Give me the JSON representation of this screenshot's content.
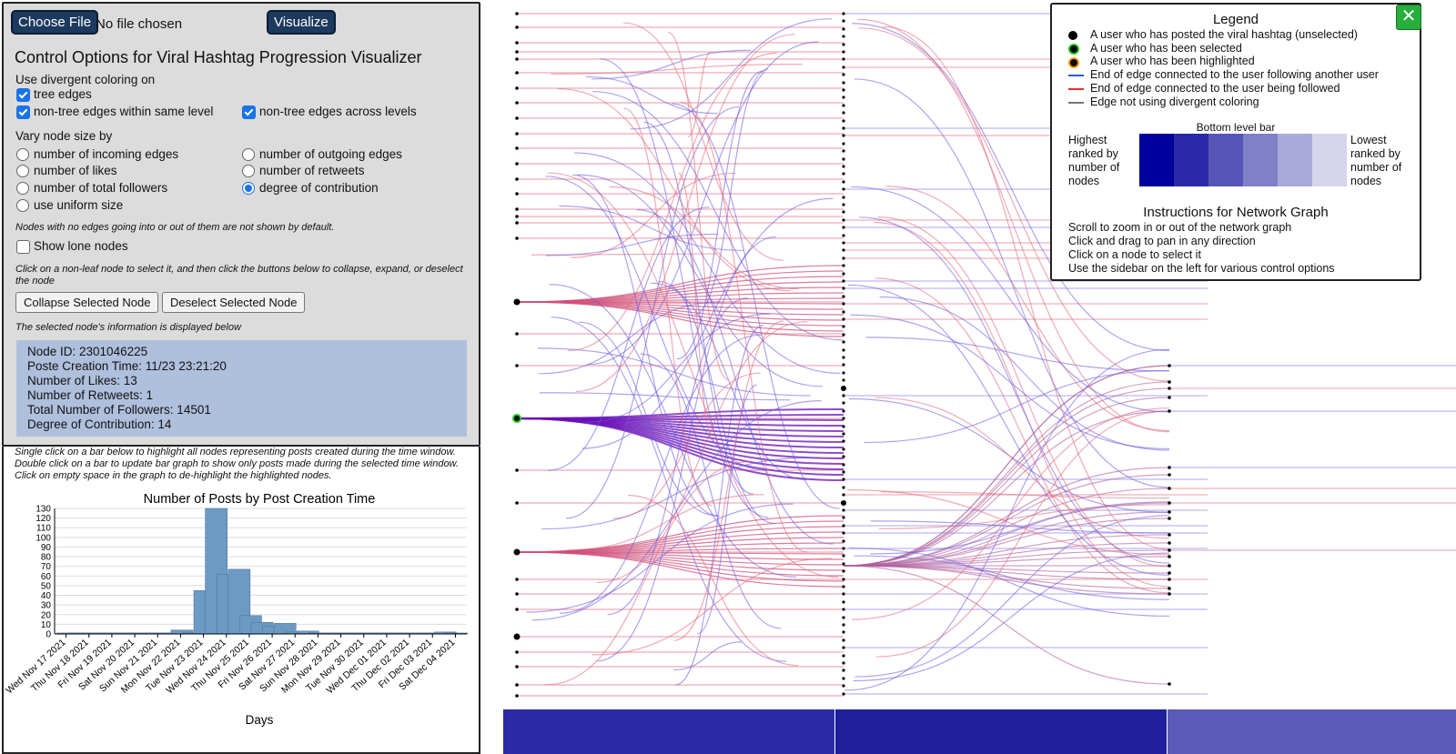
{
  "top": {
    "choose_file": "Choose File",
    "no_file": "No file chosen",
    "visualize": "Visualize"
  },
  "controls": {
    "title": "Control Options for Viral Hashtag Progression Visualizer",
    "divergent_label": "Use divergent coloring on",
    "divergent": [
      {
        "label": "tree edges",
        "checked": true
      },
      {
        "label": "non-tree edges within same level",
        "checked": true
      },
      {
        "label": "non-tree edges across levels",
        "checked": true
      }
    ],
    "size_label": "Vary node size by",
    "size_options": [
      {
        "label": "number of incoming edges",
        "selected": false
      },
      {
        "label": "number of outgoing edges",
        "selected": false
      },
      {
        "label": "number of likes",
        "selected": false
      },
      {
        "label": "number of retweets",
        "selected": false
      },
      {
        "label": "number of total followers",
        "selected": false
      },
      {
        "label": "degree of contribution",
        "selected": true
      },
      {
        "label": "use uniform size",
        "selected": false
      }
    ],
    "lone_note": "Nodes with no edges going into or out of them are not shown by default.",
    "lone_label": "Show lone nodes",
    "lone_checked": false,
    "select_note": "Click on a non-leaf node to select it, and then click the buttons below to collapse, expand, or deselect the node",
    "collapse_btn": "Collapse Selected Node",
    "deselect_btn": "Deselect Selected Node",
    "info_note": "The selected node's information is displayed below",
    "info": [
      "Node ID: 2301046225",
      "Poste Creation Time: 11/23 23:21:20",
      "Number of Likes: 13",
      "Number of Retweets: 1",
      "Total Number of Followers: 14501",
      "Degree of Contribution: 14"
    ]
  },
  "barpanel": {
    "note": "Single click on a bar below to highlight all nodes representing posts created during the time window. Double click on a bar to update bar graph to show only posts made during the selected time window. Click on empty space in the graph to de-highlight the highlighted nodes."
  },
  "chart_data": {
    "type": "bar",
    "title": "Number of Posts by Post Creation Time",
    "xlabel": "Days",
    "ylabel": "",
    "ylim": [
      0,
      130
    ],
    "yticks": [
      0,
      10,
      20,
      30,
      40,
      50,
      60,
      70,
      80,
      90,
      100,
      110,
      120,
      130
    ],
    "categories": [
      "Wed Nov 17 2021",
      "Thu Nov 18 2021",
      "Fri Nov 19 2021",
      "Sat Nov 20 2021",
      "Sun Nov 21 2021",
      "Mon Nov 22 2021",
      "Tue Nov 23 2021",
      "Wed Nov 24 2021",
      "Thu Nov 25 2021",
      "Fri Nov 26 2021",
      "Sat Nov 27 2021",
      "Sun Nov 28 2021",
      "Mon Nov 29 2021",
      "Tue Nov 30 2021",
      "Wed Dec 01 2021",
      "Thu Dec 02 2021",
      "Fri Dec 03 2021",
      "Sat Dec 04 2021"
    ],
    "bars": [
      {
        "start": 0.0,
        "value": 1
      },
      {
        "start": 0.5,
        "value": 1
      },
      {
        "start": 1.0,
        "value": 1
      },
      {
        "start": 1.5,
        "value": 1
      },
      {
        "start": 2.0,
        "value": 1
      },
      {
        "start": 2.5,
        "value": 1
      },
      {
        "start": 3.0,
        "value": 1
      },
      {
        "start": 3.5,
        "value": 1
      },
      {
        "start": 4.0,
        "value": 1
      },
      {
        "start": 4.5,
        "value": 1
      },
      {
        "start": 5.0,
        "value": 4
      },
      {
        "start": 5.5,
        "value": 1
      },
      {
        "start": 6.0,
        "value": 45
      },
      {
        "start": 6.5,
        "value": 130
      },
      {
        "start": 7.0,
        "value": 62
      },
      {
        "start": 7.5,
        "value": 67
      },
      {
        "start": 8.0,
        "value": 19
      },
      {
        "start": 8.5,
        "value": 12
      },
      {
        "start": 9.0,
        "value": 8
      },
      {
        "start": 9.5,
        "value": 11
      },
      {
        "start": 10.0,
        "value": 2
      },
      {
        "start": 10.5,
        "value": 3
      },
      {
        "start": 11.0,
        "value": 1
      },
      {
        "start": 11.5,
        "value": 1
      },
      {
        "start": 12.0,
        "value": 1
      },
      {
        "start": 12.5,
        "value": 1
      },
      {
        "start": 13.0,
        "value": 1
      },
      {
        "start": 13.5,
        "value": 1
      },
      {
        "start": 14.0,
        "value": 1
      },
      {
        "start": 14.5,
        "value": 1
      },
      {
        "start": 15.0,
        "value": 1
      },
      {
        "start": 15.5,
        "value": 1
      },
      {
        "start": 16.0,
        "value": 1
      },
      {
        "start": 16.5,
        "value": 2
      },
      {
        "start": 17.0,
        "value": 1
      }
    ],
    "bar_color": "#6b9ac4",
    "grid": true
  },
  "legend": {
    "title": "Legend",
    "items": [
      {
        "label": "A user who has posted the viral hashtag (unselected)",
        "icon": "black-dot"
      },
      {
        "label": "A user who has been selected",
        "icon": "green-ring-dot"
      },
      {
        "label": "A user who has been highlighted",
        "icon": "orange-ring-dot"
      },
      {
        "label": "End of edge connected to the user following another user",
        "icon": "blue-line",
        "color": "#2a5bd7"
      },
      {
        "label": "End of edge connected to the user being followed",
        "icon": "red-line",
        "color": "#e03030"
      },
      {
        "label": "Edge not using divergent coloring",
        "icon": "gray-line",
        "color": "#777777"
      }
    ],
    "bar_title": "Bottom level bar",
    "highest": "Highest ranked by number of nodes",
    "lowest": "Lowest ranked by number of nodes",
    "bar_colors": [
      "#00009c",
      "#2a2aa8",
      "#5555b8",
      "#8080c9",
      "#aaaadc",
      "#d5d5ed"
    ],
    "instructions_title": "Instructions for Network Graph",
    "instructions": [
      "Scroll to zoom in or out of the network graph",
      "Click and drag to pan in any direction",
      "Click on a node to select it",
      "Use the sidebar on the left for various control options"
    ],
    "close": "✕"
  },
  "bottom_bar": {
    "colors": [
      "#2b2ba6",
      "#1f1f9c",
      "#5a5ab9"
    ]
  }
}
